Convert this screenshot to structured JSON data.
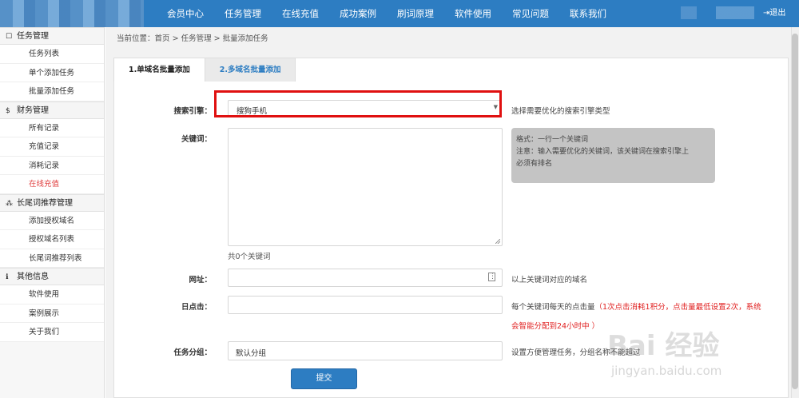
{
  "nav": {
    "items": [
      "会员中心",
      "任务管理",
      "在线充值",
      "成功案例",
      "刷词原理",
      "软件使用",
      "常见问题",
      "联系我们"
    ],
    "logout": "退出",
    "user_prefix": "("
  },
  "sidebar": {
    "groups": [
      {
        "icon": "folder-icon",
        "glyph": "☐",
        "title": "任务管理",
        "items": [
          "任务列表",
          "单个添加任务",
          "批量添加任务"
        ]
      },
      {
        "icon": "dollar-icon",
        "glyph": "$",
        "title": "财务管理",
        "items": [
          "所有记录",
          "充值记录",
          "消耗记录",
          "在线充值"
        ]
      },
      {
        "icon": "cubes-icon",
        "glyph": "⁂",
        "title": "长尾词推荐管理",
        "items": [
          "添加授权域名",
          "授权域名列表",
          "长尾词推荐列表"
        ]
      },
      {
        "icon": "info-icon",
        "glyph": "ℹ",
        "title": "其他信息",
        "items": [
          "软件使用",
          "案例展示",
          "关于我们"
        ]
      }
    ],
    "active_item": "在线充值"
  },
  "breadcrumb": {
    "prefix": "当前位置：",
    "path": [
      "首页",
      "任务管理",
      "批量添加任务"
    ],
    "separator": ">"
  },
  "tabs": [
    {
      "label": "1.单域名批量添加",
      "active": true
    },
    {
      "label": "2.多域名批量添加",
      "active": false
    }
  ],
  "form": {
    "engine": {
      "label": "搜索引擎：",
      "value": "搜狗手机",
      "hint": "选择需要优化的搜索引擎类型"
    },
    "keywords": {
      "label": "关键词：",
      "value": "",
      "count_text": "共0个关键词",
      "tip_lines": [
        "格式：一行一个关键词",
        "注意：输入需要优化的关键词，该关键词在搜索引擎上",
        "必须有排名"
      ]
    },
    "url": {
      "label": "网址：",
      "value": "",
      "hint": "以上关键词对应的域名"
    },
    "daily_clicks": {
      "label": "日点击：",
      "value": "",
      "hint_prefix": "每个关键词每天的点击量",
      "hint_red_1": "（1次点击消耗1积分，点击量最低设置2次，系统",
      "hint_red_2": "会智能分配到24小时中 ）"
    },
    "group": {
      "label": "任务分组：",
      "value": "默认分组",
      "hint": "设置方便管理任务，分组名称不能超过"
    },
    "submit_label": "提交"
  },
  "watermark": {
    "main": "Bai 经验",
    "sub": "jingyan.baidu.com"
  },
  "colors": {
    "nav_bg": "#2d7dc2",
    "highlight": "#e01010",
    "alert": "#e02020"
  }
}
